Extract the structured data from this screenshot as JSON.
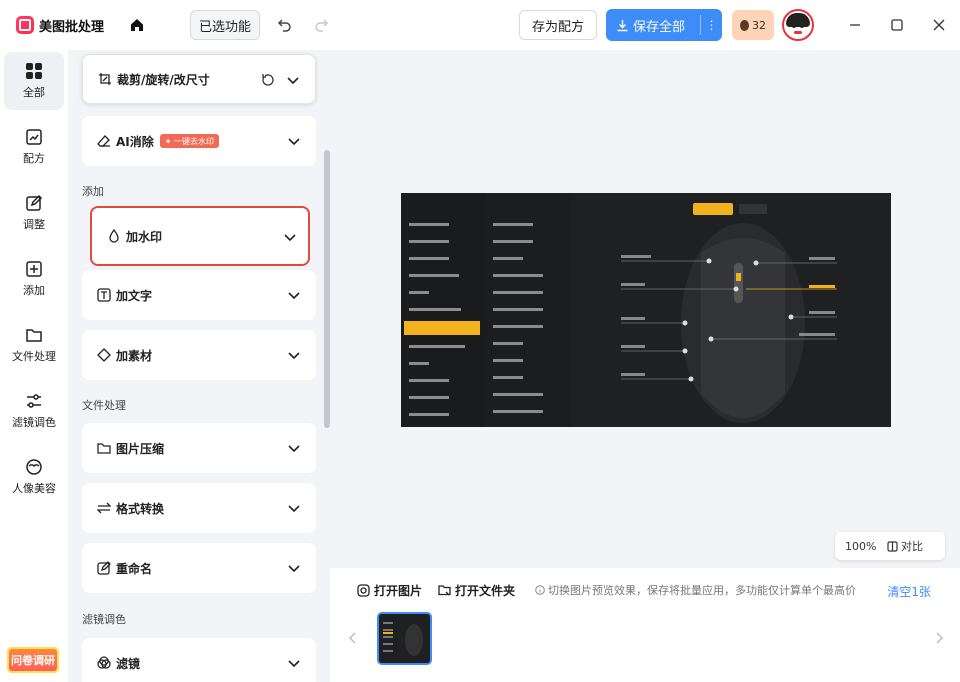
{
  "header": {
    "app_name": "美图批处理",
    "selected_features": "已选功能",
    "save_as_recipe": "存为配方",
    "save_all": "保存全部",
    "credits": "32"
  },
  "leftnav": {
    "items": [
      {
        "label": "全部",
        "icon": "grid-icon"
      },
      {
        "label": "配方",
        "icon": "recipe-icon"
      },
      {
        "label": "调整",
        "icon": "edit-icon"
      },
      {
        "label": "添加",
        "icon": "add-icon"
      },
      {
        "label": "文件处理",
        "icon": "folder-icon"
      },
      {
        "label": "滤镜调色",
        "icon": "sliders-icon"
      },
      {
        "label": "人像美容",
        "icon": "face-icon"
      }
    ],
    "survey": "问卷调研"
  },
  "panel": {
    "crop": "裁剪/旋转/改尺寸",
    "ai_remove": "AI消除",
    "ai_badge": "一键去水印",
    "section_add": "添加",
    "watermark": "加水印",
    "add_text": "加文字",
    "add_material": "加素材",
    "section_file": "文件处理",
    "compress": "图片压缩",
    "convert": "格式转换",
    "rename": "重命名",
    "section_filter": "滤镜调色",
    "filter": "滤镜"
  },
  "canvas": {
    "zoom": "100%",
    "compare": "对比"
  },
  "bottombar": {
    "open_image": "打开图片",
    "open_folder": "打开文件夹",
    "tip": "切换图片预览效果，保存将批量应用，多功能仅计算单个最高价",
    "clear": "清空1张"
  },
  "colors": {
    "accent": "#3d8cf7",
    "highlight_border": "#e0493b",
    "badge": "#f06a55"
  }
}
